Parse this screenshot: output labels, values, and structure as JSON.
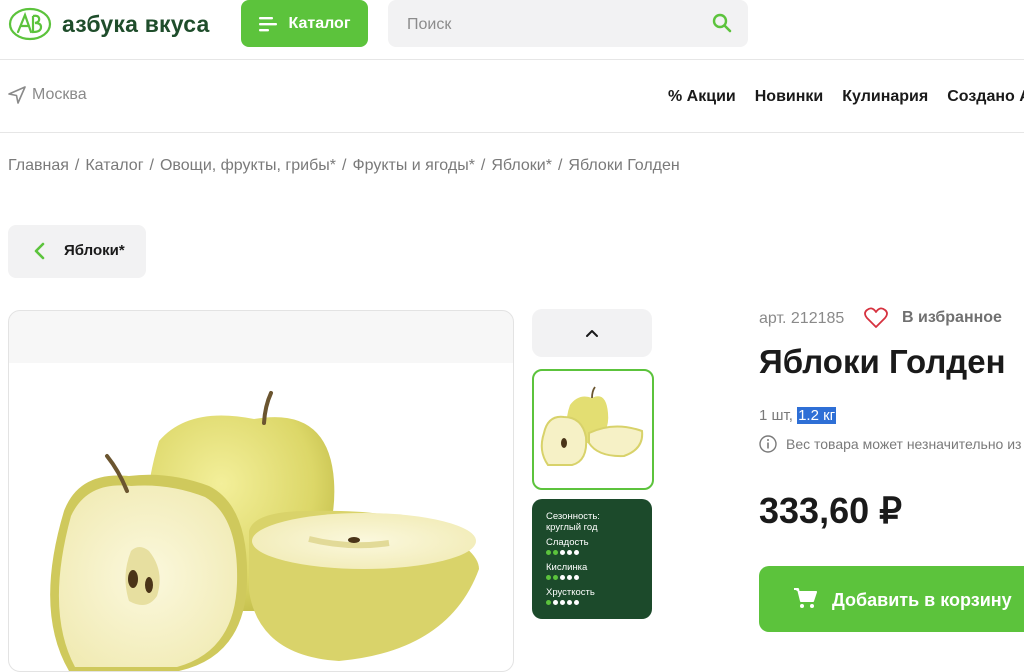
{
  "header": {
    "logo_text": "азбука вкуса",
    "catalog_label": "Каталог",
    "search_placeholder": "Поиск"
  },
  "location": {
    "city": "Москва"
  },
  "nav": {
    "items": [
      "% Акции",
      "Новинки",
      "Кулинария",
      "Создано А"
    ]
  },
  "breadcrumb": [
    "Главная",
    "Каталог",
    "Овощи, фрукты, грибы*",
    "Фрукты и ягоды*",
    "Яблоки*",
    "Яблоки Голден"
  ],
  "back": {
    "label": "Яблоки*"
  },
  "gallery": {
    "info_card": {
      "season_label": "Сезонность:",
      "season_value": "круглый год",
      "sweetness_label": "Сладость",
      "sweetness_level": 2,
      "acidity_label": "Кислинка",
      "acidity_level": 2,
      "crunch_label": "Хрусткость",
      "crunch_level": 1,
      "max_level": 5
    }
  },
  "product": {
    "article": "арт. 212185",
    "favorite_label": "В избранное",
    "title": "Яблоки Голден",
    "qty_prefix": "1 шт, ",
    "qty_weight": "1.2 кг",
    "weight_note": "Вес товара может незначительно из",
    "price": "333,60 ₽",
    "add_to_cart": "Добавить в корзину"
  },
  "colors": {
    "brand_green": "#5cc33c",
    "dark_green": "#1c4a2b",
    "logo_green": "#1f4d2b",
    "heart_red": "#d6323f",
    "selection_blue": "#2e6fd6"
  }
}
